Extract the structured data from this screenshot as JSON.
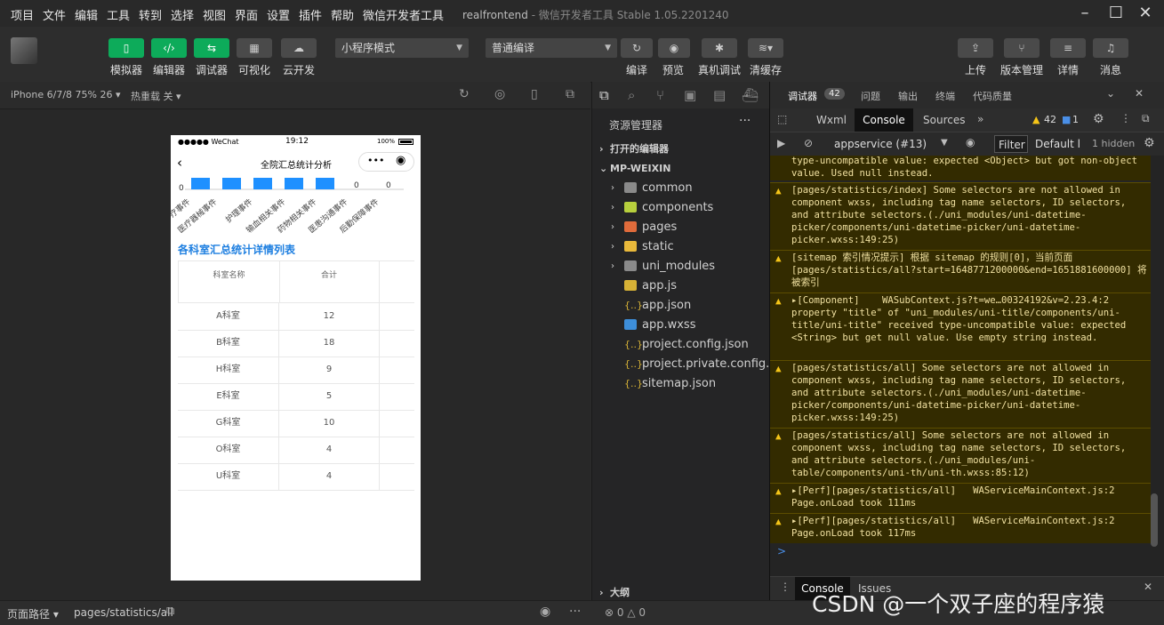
{
  "menu": [
    "项目",
    "文件",
    "编辑",
    "工具",
    "转到",
    "选择",
    "视图",
    "界面",
    "设置",
    "插件",
    "帮助",
    "微信开发者工具"
  ],
  "window_title": "realfrontend",
  "window_subtitle": "- 微信开发者工具 Stable 1.05.2201240",
  "toolbar": {
    "buttons": [
      "模拟器",
      "编辑器",
      "调试器",
      "可视化",
      "云开发"
    ],
    "mode_select": "小程序模式",
    "compile_select": "普通编译",
    "actions": [
      "编译",
      "预览",
      "真机调试",
      "清缓存"
    ],
    "right": [
      "上传",
      "版本管理",
      "详情",
      "消息"
    ]
  },
  "simulator": {
    "device": "iPhone 6/7/8 75% 26",
    "hot_reload": "热重载 关",
    "status_carrier": "●●●●● WeChat",
    "status_time": "19:12",
    "status_battery": "100%",
    "page_title": "全院汇总统计分析",
    "axis_zero": "0",
    "bar_labels": [
      "诊疗事件",
      "医疗器械事件",
      "护理事件",
      "输血相关事件",
      "药物相关事件",
      "医患沟通事件",
      "后勤保障事件"
    ],
    "zero_labels": [
      "0",
      "0"
    ],
    "section_title": "各科室汇总统计详情列表",
    "table_headers": [
      "科室名称",
      "合计"
    ],
    "rows": [
      {
        "name": "A科室",
        "total": "12"
      },
      {
        "name": "B科室",
        "total": "18"
      },
      {
        "name": "H科室",
        "total": "9"
      },
      {
        "name": "E科室",
        "total": "5"
      },
      {
        "name": "G科室",
        "total": "10"
      },
      {
        "name": "O科室",
        "total": "4"
      },
      {
        "name": "U科室",
        "total": "4"
      }
    ]
  },
  "explorer": {
    "title": "资源管理器",
    "open_editors": "打开的编辑器",
    "root": "MP-WEIXIN",
    "folders": [
      "common",
      "components",
      "pages",
      "static",
      "uni_modules"
    ],
    "files": [
      "app.js",
      "app.json",
      "app.wxss",
      "project.config.json",
      "project.private.config.js...",
      "sitemap.json"
    ],
    "outline": "大纲",
    "problems": "0",
    "warnings": "0"
  },
  "devtools": {
    "tabs": [
      "调试器",
      "问题",
      "输出",
      "终端",
      "代码质量"
    ],
    "tab_badge": "42",
    "panel_tabs": [
      "Wxml",
      "Console",
      "Sources"
    ],
    "warn_count": "42",
    "info_count": "1",
    "context": "appservice (#13)",
    "filter": "Filter",
    "levels": "Default l",
    "hidden": "1 hidden",
    "logs": [
      "type-uncompatible value: expected <Object> but got non-object value. Used null instead.",
      "[pages/statistics/index] Some selectors are not allowed in component wxss, including tag name selectors, ID selectors, and attribute selectors.(./uni_modules/uni-datetime-picker/components/uni-datetime-picker/uni-datetime-picker.wxss:149:25)",
      "[sitemap 索引情况提示] 根据 sitemap 的规则[0]，当前页面 [pages/statistics/all?start=1648771200000&end=1651881600000] 将被索引",
      "▸[Component]    WASubContext.js?t=we…00324192&v=2.23.4:2 property \"title\" of \"uni_modules/uni-title/components/uni-title/uni-title\" received type-uncompatible value: expected <String> but get null value. Use empty string instead.",
      "[pages/statistics/all] Some selectors are not allowed in component wxss, including tag name selectors, ID selectors, and attribute selectors.(./uni_modules/uni-datetime-picker/components/uni-datetime-picker/uni-datetime-picker.wxss:149:25)",
      "[pages/statistics/all] Some selectors are not allowed in component wxss, including tag name selectors, ID selectors, and attribute selectors.(./uni_modules/uni-table/components/uni-th/uni-th.wxss:85:12)",
      "▸[Perf][pages/statistics/all]   WAServiceMainContext.js:2 Page.onLoad took 111ms",
      "▸[Perf][pages/statistics/all]   WAServiceMainContext.js:2 Page.onLoad took 117ms"
    ],
    "prompt": ">",
    "drawer_tabs": [
      "Console",
      "Issues"
    ]
  },
  "statusbar": {
    "path_label": "页面路径",
    "path": "pages/statistics/all"
  },
  "watermark": "CSDN @一个双子座的程序猿"
}
